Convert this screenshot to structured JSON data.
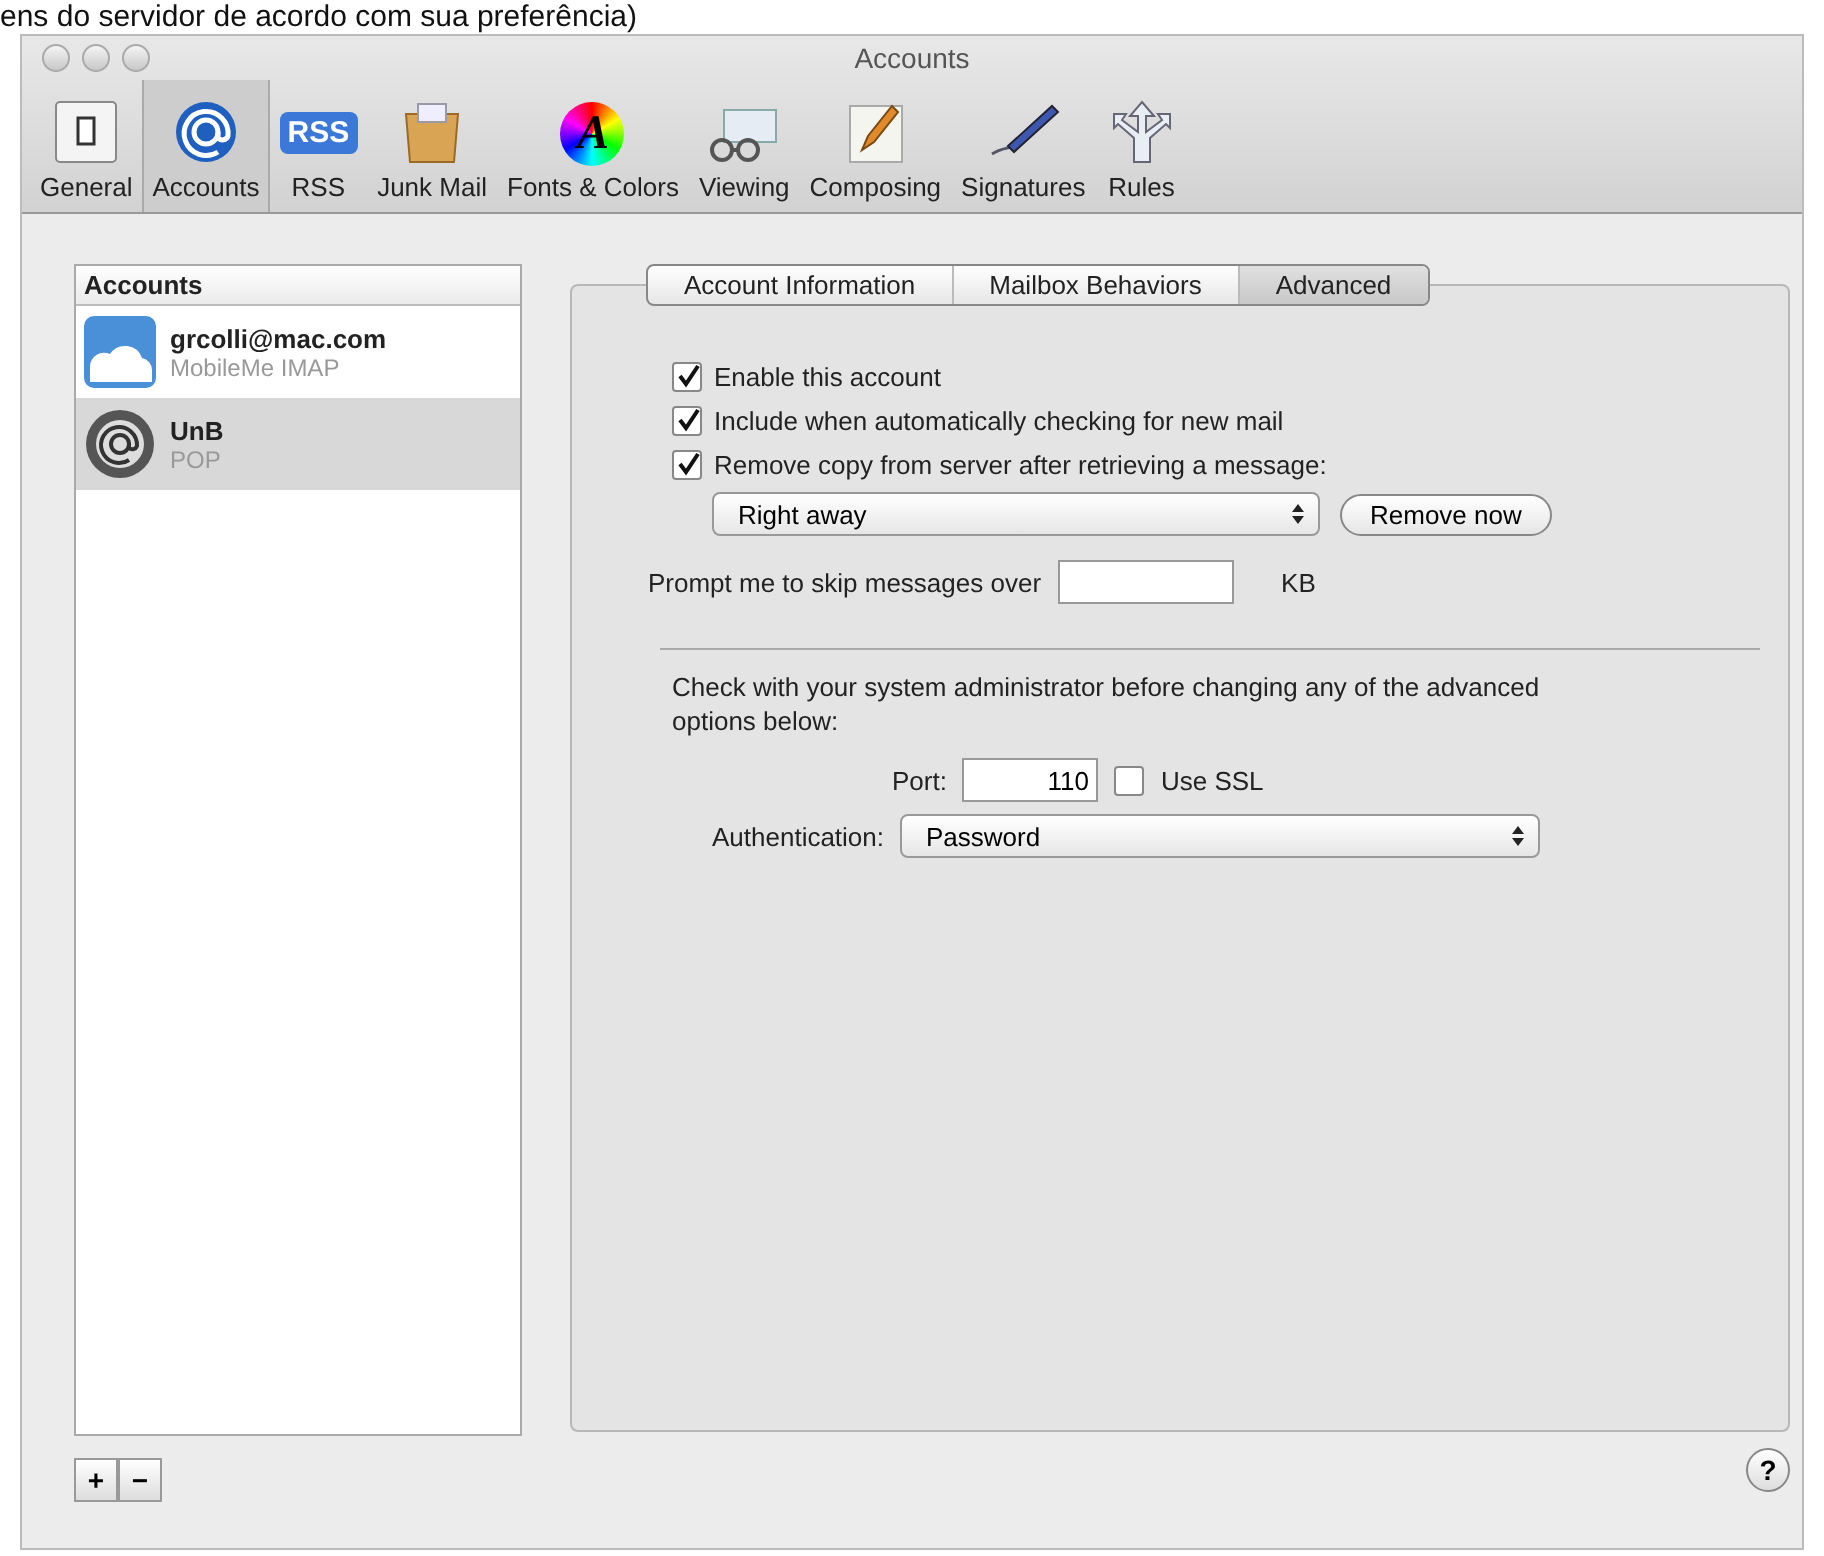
{
  "caption": "ens do servidor de acordo com sua preferência)",
  "window": {
    "title": "Accounts"
  },
  "toolbar": [
    {
      "label": "General",
      "kind": "switch",
      "selected": false
    },
    {
      "label": "Accounts",
      "kind": "at",
      "selected": true
    },
    {
      "label": "RSS",
      "kind": "rss",
      "badge": "RSS",
      "selected": false
    },
    {
      "label": "Junk Mail",
      "kind": "bag",
      "selected": false
    },
    {
      "label": "Fonts & Colors",
      "kind": "wheel",
      "glyph": "A",
      "selected": false
    },
    {
      "label": "Viewing",
      "kind": "glasses",
      "selected": false
    },
    {
      "label": "Composing",
      "kind": "pencil",
      "selected": false
    },
    {
      "label": "Signatures",
      "kind": "pen",
      "selected": false
    },
    {
      "label": "Rules",
      "kind": "arrows",
      "selected": false
    }
  ],
  "accounts_list": {
    "header": "Accounts",
    "items": [
      {
        "name": "grcolli@mac.com",
        "type": "MobileMe IMAP",
        "kind": "cloud",
        "selected": false
      },
      {
        "name": "UnB",
        "type": "POP",
        "kind": "at",
        "selected": true
      }
    ]
  },
  "tabs": [
    {
      "label": "Account Information",
      "selected": false
    },
    {
      "label": "Mailbox Behaviors",
      "selected": false
    },
    {
      "label": "Advanced",
      "selected": true
    }
  ],
  "options": [
    {
      "label": "Enable this account",
      "checked": true
    },
    {
      "label": "Include when automatically checking for new mail",
      "checked": true
    },
    {
      "label": "Remove copy from server after retrieving a message:",
      "checked": true
    }
  ],
  "remove_when": {
    "value": "Right away"
  },
  "remove_now_button": "Remove now",
  "skip_prompt": {
    "label": "Prompt me to skip messages over",
    "unit": "KB"
  },
  "admin_note": "Check with your system administrator before changing any of the advanced options below:",
  "port": {
    "label": "Port:",
    "value": "110"
  },
  "use_ssl": {
    "label": "Use SSL",
    "checked": false
  },
  "authentication": {
    "label": "Authentication:",
    "value": "Password"
  },
  "list_buttons": [
    "+",
    "−"
  ],
  "help_button": "?"
}
